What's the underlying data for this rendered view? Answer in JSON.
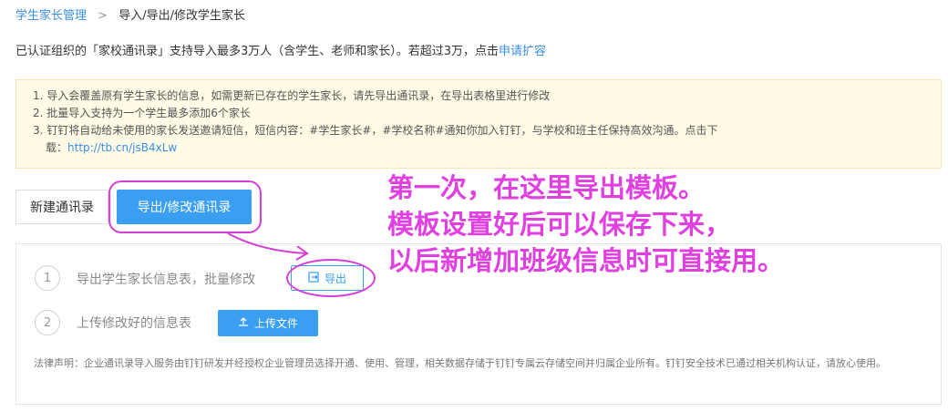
{
  "breadcrumb": {
    "parent": "学生家长管理",
    "separator": ">",
    "current": "导入/导出/修改学生家长"
  },
  "intro": {
    "text": "已认证组织的「家校通讯录」支持导入最多3万人（含学生、老师和家长）。若超过3万，点击",
    "link": "申请扩容"
  },
  "notice": {
    "line1": "1. 导入会覆盖原有学生家长的信息，如需更新已存在的学生家长，请先导出通讯录，在导出表格里进行修改",
    "line2": "2. 批量导入支持为一个学生最多添加6个家长",
    "line3": "3. 钉钉将自动给未使用的家长发送邀请短信，短信内容：#学生家长#，#学校名称#通知你加入钉钉，与学校和班主任保持高效沟通。点击下",
    "line4_prefix": "载：",
    "line4_link": "http://tb.cn/jsB4xLw"
  },
  "tabs": {
    "new_label": "新建通讯录",
    "export_label": "导出/修改通讯录"
  },
  "steps": [
    {
      "num": "1",
      "text": "导出学生家长信息表，批量修改",
      "button": "导出",
      "icon": "export-icon"
    },
    {
      "num": "2",
      "text": "上传修改好的信息表",
      "button": "上传文件",
      "icon": "upload-icon"
    }
  ],
  "legal": "法律声明：企业通讯录导入服务由钉钉研发并经授权企业管理员选择开通、使用、管理，相关数据存储于钉钉专属云存储空间并归属企业所有。钉钉安全技术已通过相关机构认证，请放心使用。",
  "annotation": {
    "line1": "第一次，在这里导出模板。",
    "line2": "模板设置好后可以保存下来，",
    "line3": "以后新增加班级信息时可直接用。",
    "color": "#e040e0"
  },
  "colors": {
    "accent": "#3a9ff0",
    "notice_bg": "#fffbe6",
    "annotation": "#d63fd6"
  }
}
